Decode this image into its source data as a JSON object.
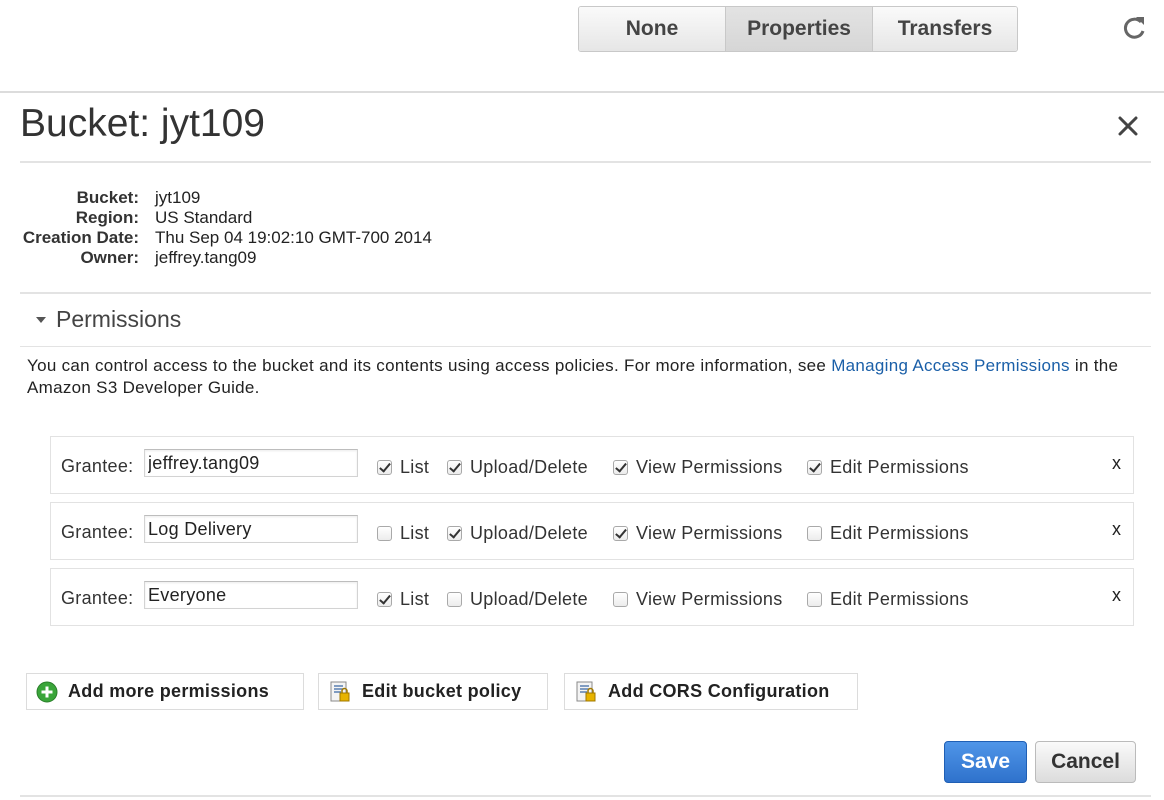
{
  "toolbar": {
    "tabs": [
      {
        "label": "None"
      },
      {
        "label": "Properties",
        "active": true
      },
      {
        "label": "Transfers"
      }
    ],
    "refresh_icon": "refresh-icon"
  },
  "header": {
    "title": "Bucket: jyt109",
    "close_icon": "close-icon"
  },
  "info": {
    "rows": [
      {
        "label": "Bucket:",
        "value": "jyt109"
      },
      {
        "label": "Region:",
        "value": "US Standard"
      },
      {
        "label": "Creation Date:",
        "value": "Thu Sep 04 19:02:10 GMT-700 2014"
      },
      {
        "label": "Owner:",
        "value": "jeffrey.tang09"
      }
    ]
  },
  "permissions": {
    "title": "Permissions",
    "description_prefix": "You can control access to the bucket and its contents using access policies. For more information, see ",
    "description_link": "Managing Access Permissions",
    "description_suffix": " in the Amazon S3 Developer Guide.",
    "grantee_label": "Grantee:",
    "checkbox_labels": {
      "list": "List",
      "upload": "Upload/Delete",
      "view": "View Permissions",
      "edit": "Edit Permissions"
    },
    "remove_label": "x",
    "grants": [
      {
        "grantee": "jeffrey.tang09",
        "list": true,
        "upload": true,
        "view": true,
        "edit": true
      },
      {
        "grantee": "Log Delivery",
        "list": false,
        "upload": true,
        "view": true,
        "edit": false
      },
      {
        "grantee": "Everyone",
        "list": true,
        "upload": false,
        "view": false,
        "edit": false
      }
    ]
  },
  "actions": {
    "add_more": "Add more permissions",
    "edit_policy": "Edit bucket policy",
    "add_cors": "Add CORS Configuration"
  },
  "footer": {
    "save": "Save",
    "cancel": "Cancel"
  },
  "colors": {
    "accent": "#2f72cc",
    "link": "#1a5fa8",
    "add_icon": "#3aa53a"
  }
}
